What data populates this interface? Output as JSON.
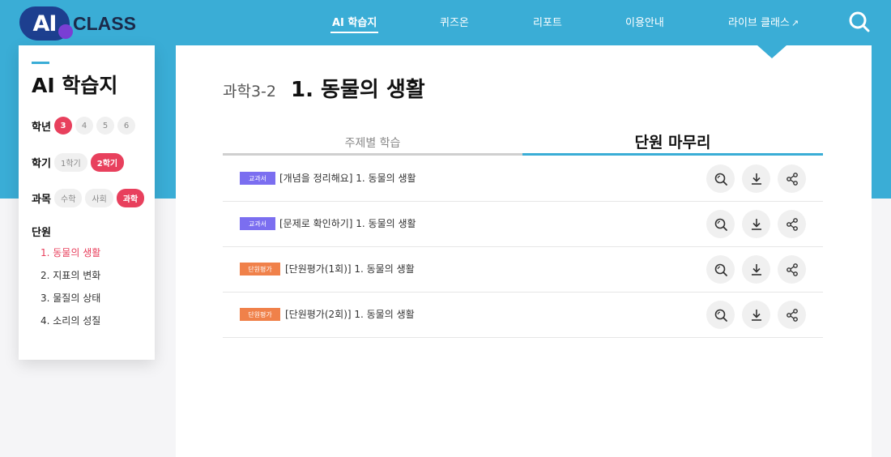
{
  "header": {
    "logo_ai": "AI",
    "logo_class": "CLASS",
    "nav": [
      {
        "label": "AI 학습지",
        "active": true
      },
      {
        "label": "퀴즈온",
        "active": false
      },
      {
        "label": "리포트",
        "active": false
      },
      {
        "label": "이용안내",
        "active": false
      },
      {
        "label": "라이브 클래스",
        "external": "↗",
        "active": false
      }
    ],
    "search_icon": "search-icon"
  },
  "sidebar": {
    "title": "AI 학습지",
    "grade": {
      "label": "학년",
      "options": [
        "3",
        "4",
        "5",
        "6"
      ],
      "selected": "3"
    },
    "semester": {
      "label": "학기",
      "options": [
        "1학기",
        "2학기"
      ],
      "selected": "2학기"
    },
    "subject": {
      "label": "과목",
      "options": [
        "수학",
        "사회",
        "과학"
      ],
      "selected": "과학"
    },
    "unit": {
      "label": "단원",
      "items": [
        "1. 동물의 생활",
        "2. 지표의 변화",
        "3. 물질의 상태",
        "4. 소리의 성질"
      ],
      "selected": "1. 동물의 생활"
    }
  },
  "main": {
    "subject": "과학3-2",
    "title": "1. 동물의 생활",
    "tabs": [
      {
        "label": "주제별 학습",
        "active": false
      },
      {
        "label": "단원 마무리",
        "active": true
      }
    ],
    "rows": [
      {
        "badge": "교과서",
        "title": "[개념을 정리해요] 1. 동물의 생활"
      },
      {
        "badge": "교과서",
        "title": "[문제로 확인하기] 1. 동물의 생활"
      },
      {
        "badge": "단원평가",
        "title": "[단원평가(1회)] 1. 동물의 생활"
      },
      {
        "badge": "단원평가",
        "title": "[단원평가(2회)] 1. 동물의 생활"
      }
    ],
    "action_icons": [
      "preview-icon",
      "download-icon",
      "share-icon"
    ]
  },
  "colors": {
    "brand_blue": "#3aadd6",
    "accent_pink": "#e8405d",
    "badge_textbook": "#7b6ef0",
    "badge_unit_eval": "#f0814a"
  }
}
